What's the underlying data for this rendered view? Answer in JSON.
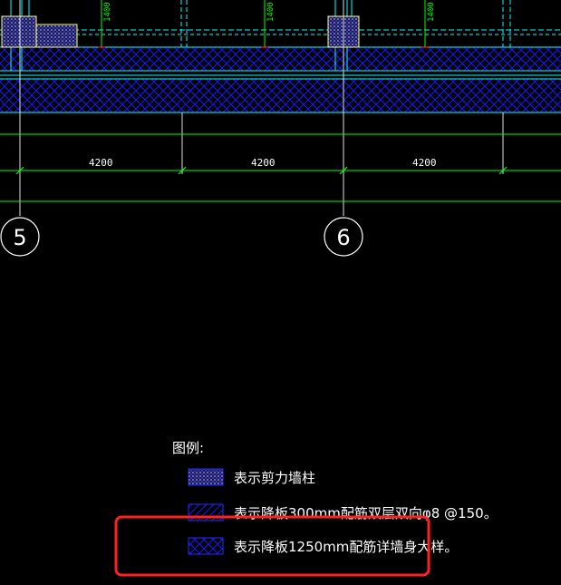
{
  "drawing": {
    "span_dimensions": [
      "4200",
      "4200",
      "4200"
    ],
    "vertical_dimensions": [
      "1400",
      "1400",
      "1400"
    ],
    "axes": [
      "5",
      "6"
    ]
  },
  "legend": {
    "title": "图例:",
    "items": [
      {
        "hatch": "dotted-crosshatch",
        "text": "表示剪力墙柱"
      },
      {
        "hatch": "diagonal",
        "text": "表示降板300mm配筋双层双向φ8 @150。"
      },
      {
        "hatch": "crosshatch",
        "text": "表示降板1250mm配筋详墙身大样。"
      }
    ]
  },
  "colors": {
    "background": "#000000",
    "grid_line": "#00ff00",
    "wall": "#00ffff",
    "hatch": "#0000ff",
    "column_fill": "#ffff66",
    "highlight_box": "#ff2020",
    "text": "#ffffff",
    "red_mark": "#ff0000"
  }
}
